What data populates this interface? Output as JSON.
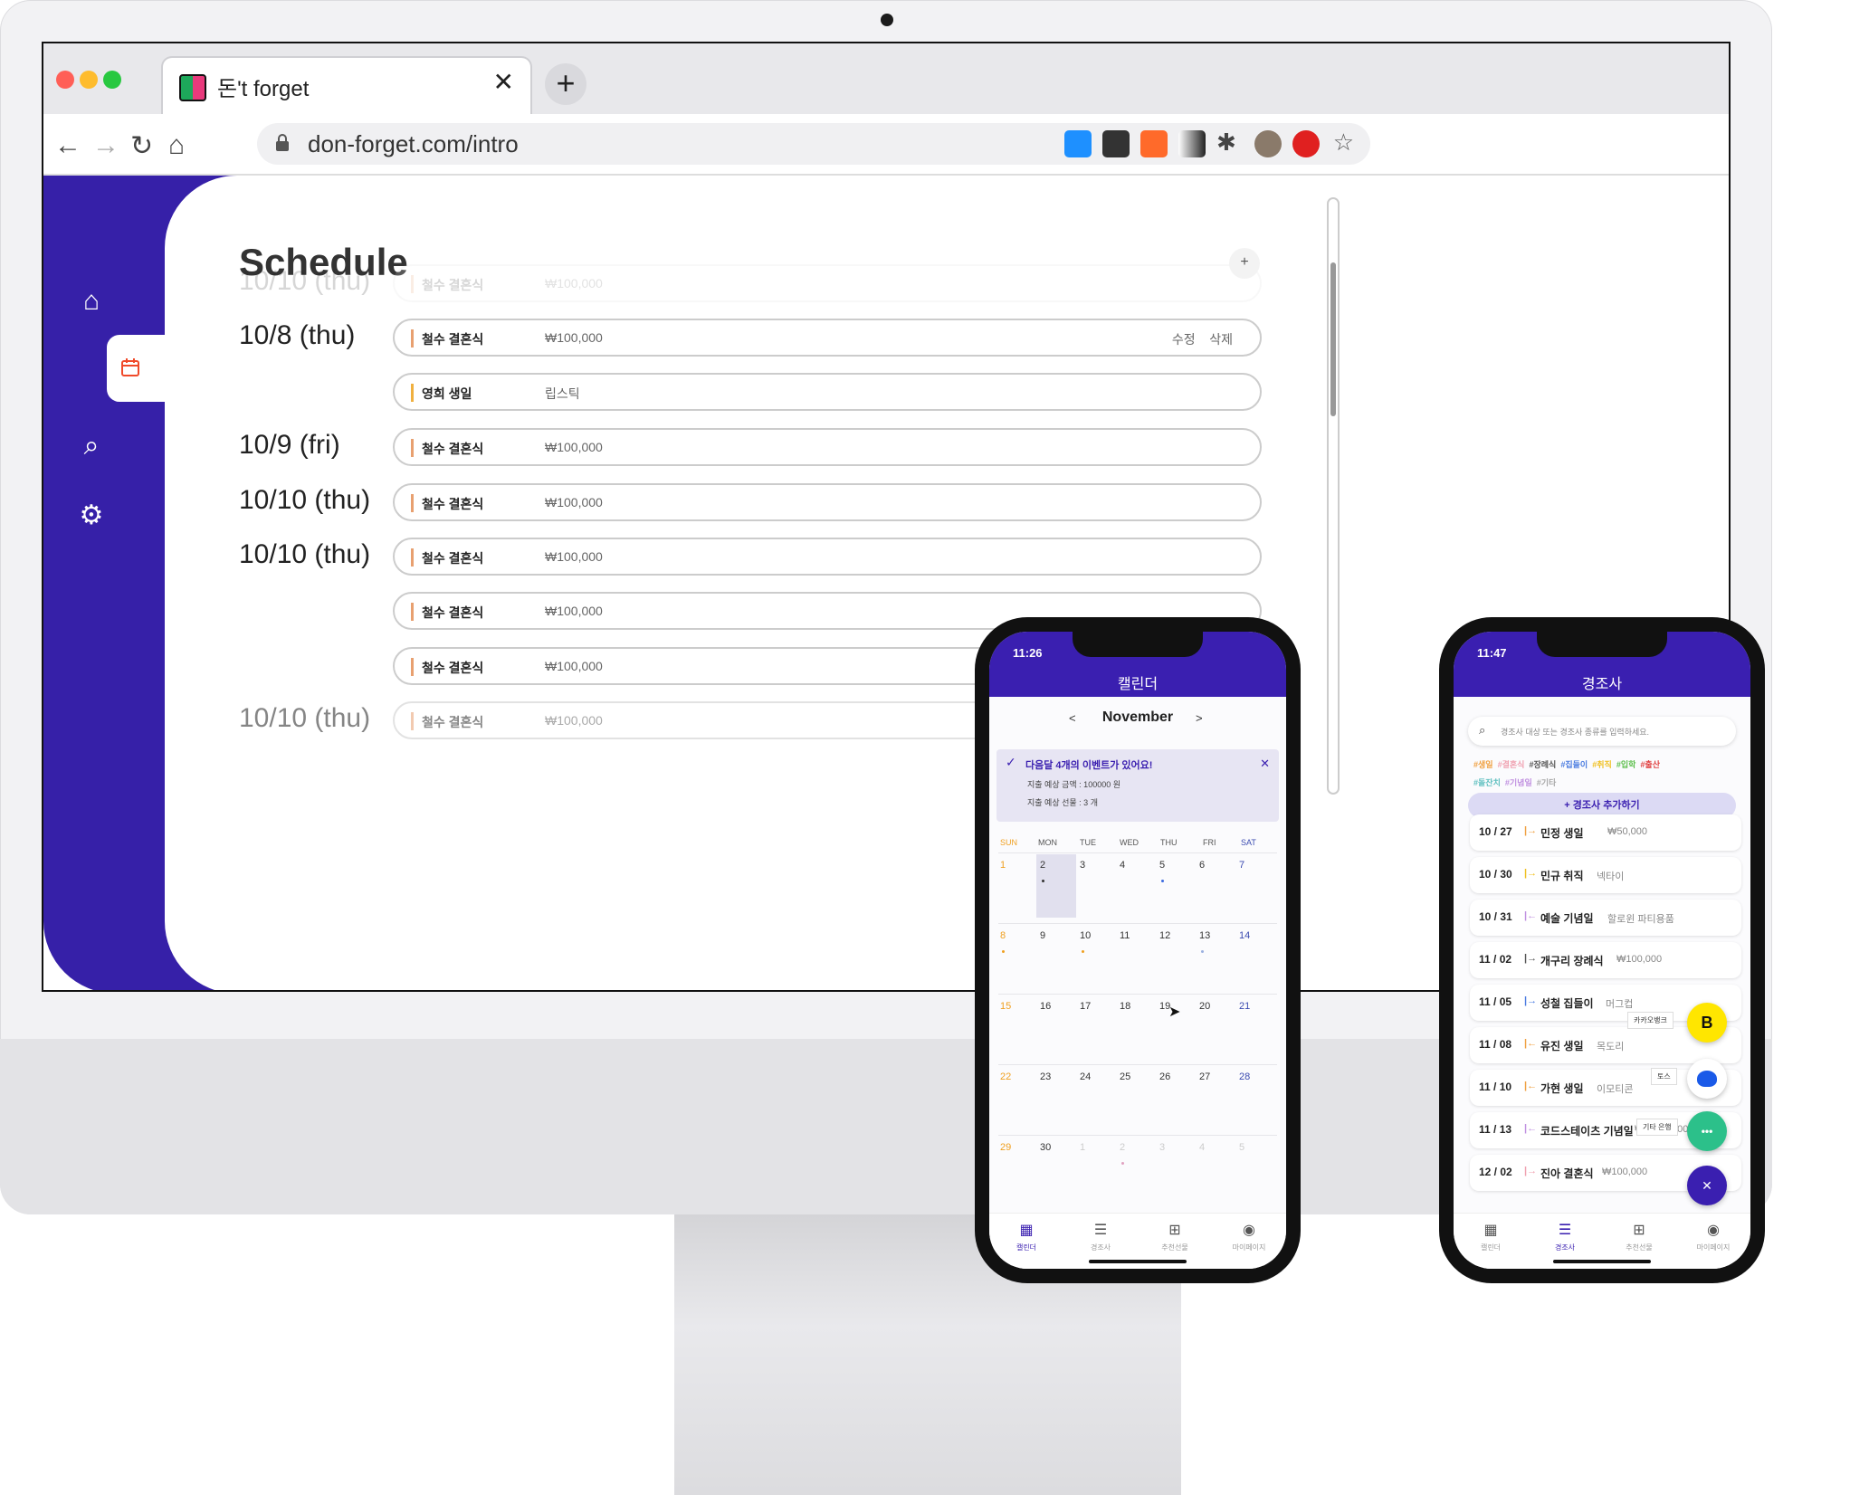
{
  "browser": {
    "tab_title": "돈't forget",
    "url": "don-forget.com/intro",
    "tab_close": "✕",
    "new_tab": "+"
  },
  "desktop": {
    "title": "Schedule",
    "ghost_date": "10/10 (thu)",
    "ghost_name": "철수 결혼식",
    "ghost_amount": "₩100,000",
    "dates": [
      "10/8 (thu)",
      "10/9 (fri)",
      "10/10 (thu)",
      "10/10 (thu)"
    ],
    "last_date": "10/10 (thu)",
    "rows": [
      {
        "name": "철수 결혼식",
        "value": "₩100,000",
        "edit": "수정",
        "delete": "삭제"
      },
      {
        "name": "영희 생일",
        "value": "립스틱"
      },
      {
        "name": "철수 결혼식",
        "value": "₩100,000"
      },
      {
        "name": "철수 결혼식",
        "value": "₩100,000"
      },
      {
        "name": "철수 결혼식",
        "value": "₩100,000"
      },
      {
        "name": "철수 결혼식",
        "value": "₩100,000"
      },
      {
        "name": "철수 결혼식",
        "value": "₩100,000"
      },
      {
        "name": "철수 결혼식",
        "value": "₩100,000"
      }
    ],
    "add_button": "+"
  },
  "phone1": {
    "time": "11:26",
    "header": "캘린더",
    "prev": "<",
    "month": "November",
    "next": ">",
    "alert_title": "다음달 4개의 이벤트가 있어요!",
    "alert_line1": "지출 예상 금액 : 100000 원",
    "alert_line2": "지출 예상 선물 : 3 개",
    "alert_close": "✕",
    "weekdays": [
      "SUN",
      "MON",
      "TUE",
      "WED",
      "THU",
      "FRI",
      "SAT"
    ],
    "weeks": [
      [
        "1",
        "2",
        "3",
        "4",
        "5",
        "6",
        "7"
      ],
      [
        "8",
        "9",
        "10",
        "11",
        "12",
        "13",
        "14"
      ],
      [
        "15",
        "16",
        "17",
        "18",
        "19",
        "20",
        "21"
      ],
      [
        "22",
        "23",
        "24",
        "25",
        "26",
        "27",
        "28"
      ],
      [
        "29",
        "30",
        "1",
        "2",
        "3",
        "4",
        "5"
      ]
    ],
    "tabs": [
      "캘린더",
      "경조사",
      "추천선물",
      "마이페이지"
    ]
  },
  "phone2": {
    "time": "11:47",
    "header": "경조사",
    "search_placeholder": "경조사 대상 또는 경조사 종류를 입력하세요.",
    "tags_row1": [
      "#생일",
      "#결혼식",
      "#장례식",
      "#집들이",
      "#취직",
      "#입학",
      "#출산"
    ],
    "tags_row2": [
      "#돌잔치",
      "#기념일",
      "#기타"
    ],
    "tag_colors": [
      "#f0a040",
      "#f0a0b0",
      "#555555",
      "#4a7be0",
      "#f0c020",
      "#60c050",
      "#e04040",
      "#60c0c0",
      "#c090e0",
      "#aaaaaa"
    ],
    "add_button": "+ 경조사 추가하기",
    "items": [
      {
        "date": "10 / 27",
        "arrow": "|→",
        "name": "민정 생일",
        "value": "₩50,000"
      },
      {
        "date": "10 / 30",
        "arrow": "|→",
        "name": "민규 취직",
        "value": "넥타이"
      },
      {
        "date": "10 / 31",
        "arrow": "|←",
        "name": "예술 기념일",
        "value": "할로윈 파티용품"
      },
      {
        "date": "11 / 02",
        "arrow": "|→",
        "name": "개구리 장례식",
        "value": "₩100,000"
      },
      {
        "date": "11 / 05",
        "arrow": "|→",
        "name": "성철 집들이",
        "value": "머그컵"
      },
      {
        "date": "11 / 08",
        "arrow": "|←",
        "name": "유진 생일",
        "value": "목도리"
      },
      {
        "date": "11 / 10",
        "arrow": "|←",
        "name": "가현 생일",
        "value": "이모티콘"
      },
      {
        "date": "11 / 13",
        "arrow": "|←",
        "name": "코드스테이츠 기념일",
        "value": "₩1,000,000"
      },
      {
        "date": "12 / 02",
        "arrow": "|→",
        "name": "진아 결혼식",
        "value": "₩100,000"
      }
    ],
    "fab_labels": [
      "카카오뱅크",
      "토스",
      "기타 은행"
    ],
    "fab_kakao": "B",
    "fab_etc": "•••",
    "fab_close": "✕",
    "tabs": [
      "캘린더",
      "경조사",
      "추천선물",
      "마이페이지"
    ]
  }
}
